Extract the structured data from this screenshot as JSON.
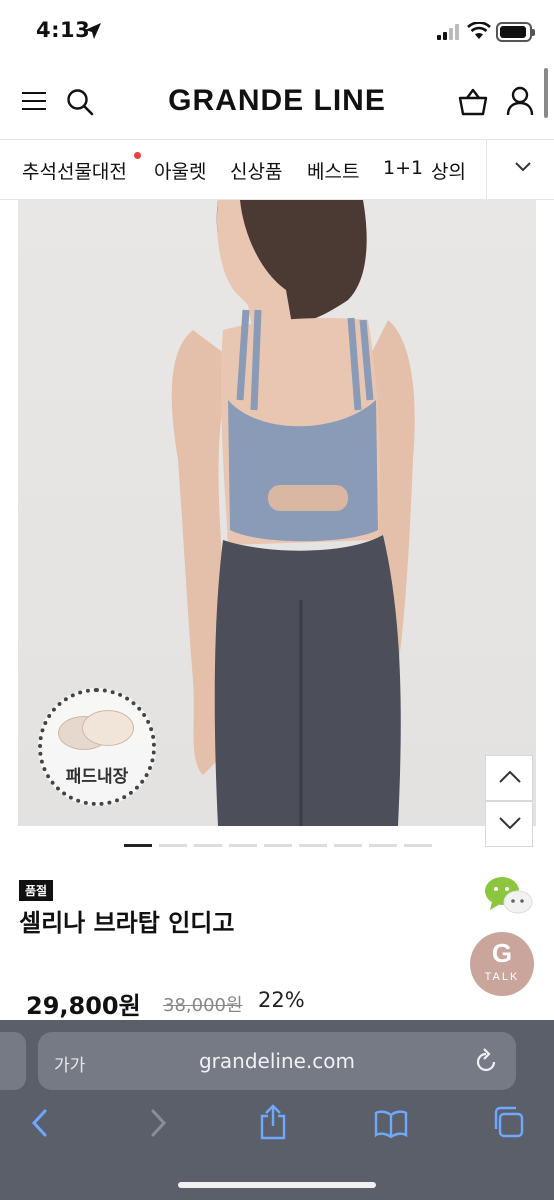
{
  "status": {
    "time": "4:13"
  },
  "header": {
    "brand": "GRANDE LINE"
  },
  "categories": [
    {
      "label": "추석선물대전",
      "has_dot": true
    },
    {
      "label": "아울렛"
    },
    {
      "label": "신상품"
    },
    {
      "label": "베스트"
    },
    {
      "label": "1+1"
    },
    {
      "label": "상의"
    }
  ],
  "product": {
    "image_badge": "패드내장",
    "tag": "품절",
    "name": "셀리나 브라탑 인디고",
    "price": "29,800원",
    "original_price": "38,000원",
    "discount": "22%",
    "gallery": {
      "total": 9,
      "active_index": 1
    }
  },
  "gtalk": {
    "letter": "G",
    "label": "TALK"
  },
  "browser": {
    "aa_label": "가가",
    "url": "grandeline.com"
  },
  "colors": {
    "accent_dot": "#e8403f",
    "gtalk_bg": "#c9a59c",
    "safari_bg": "#5b5f6a",
    "icon_blue": "#6fa8ff"
  }
}
